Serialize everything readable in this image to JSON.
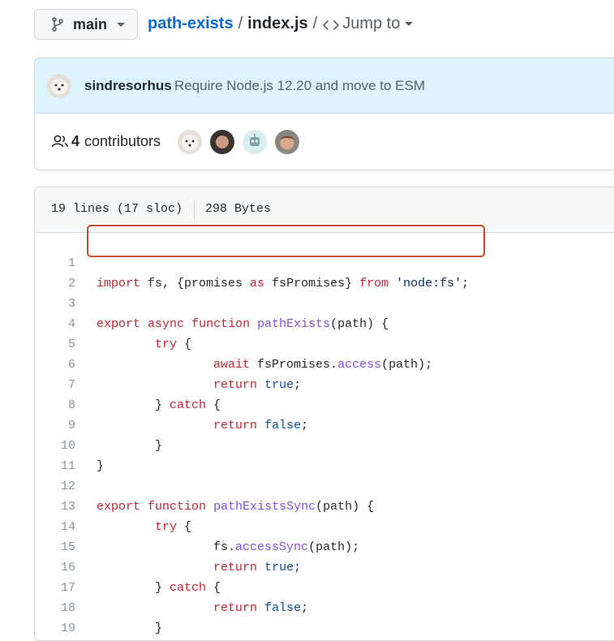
{
  "branch": {
    "label": "main"
  },
  "breadcrumb": {
    "repo": "path-exists",
    "separator": "/",
    "file": "index.js",
    "separator2": "/",
    "jump_label": "Jump to"
  },
  "commit": {
    "author": "sindresorhus",
    "message": "Require Node.js 12.20 and move to ESM"
  },
  "contributors": {
    "count": "4",
    "label": "contributors"
  },
  "file_info": {
    "lines": "19 lines (17 sloc)",
    "size": "298 Bytes"
  },
  "code": {
    "line_numbers": [
      "1",
      "2",
      "3",
      "4",
      "5",
      "6",
      "7",
      "8",
      "9",
      "10",
      "11",
      "12",
      "13",
      "14",
      "15",
      "16",
      "17",
      "18",
      "19"
    ],
    "l1": {
      "import": "import",
      "a": " fs, {promises ",
      "as": "as",
      "b": " fsPromises} ",
      "from": "from",
      "c": " ",
      "str": "'node:fs'",
      "d": ";"
    },
    "l3": {
      "export": "export",
      "async": "async",
      "function": "function",
      "name": "pathExists",
      "rest": "(path) {"
    },
    "l4": {
      "try": "try",
      "rest": " {"
    },
    "l5": {
      "await": "await",
      "a": " fsPromises.",
      "method": "access",
      "b": "(path);"
    },
    "l6": {
      "return": "return",
      "value": "true",
      "rest": ";"
    },
    "l7": {
      "a": "} ",
      "catch": "catch",
      "b": " {"
    },
    "l8": {
      "return": "return",
      "value": "false",
      "rest": ";"
    },
    "l9": {
      "text": "}"
    },
    "l10": {
      "text": "}"
    },
    "l12": {
      "export": "export",
      "function": "function",
      "name": "pathExistsSync",
      "rest": "(path) {"
    },
    "l13": {
      "try": "try",
      "rest": " {"
    },
    "l14": {
      "a": "fs.",
      "method": "accessSync",
      "b": "(path);"
    },
    "l15": {
      "return": "return",
      "value": "true",
      "rest": ";"
    },
    "l16": {
      "a": "} ",
      "catch": "catch",
      "b": " {"
    },
    "l17": {
      "return": "return",
      "value": "false",
      "rest": ";"
    },
    "l18": {
      "text": "}"
    },
    "l19": {
      "text": "}"
    }
  },
  "colors": {
    "link": "#0969da",
    "keyword": "#cf222e",
    "function": "#8250df",
    "string": "#0a3069",
    "constant": "#0550ae",
    "highlight_border": "#d1492b"
  },
  "icons": {
    "branch": "git-branch-icon",
    "code": "code-icon",
    "people": "people-icon"
  }
}
